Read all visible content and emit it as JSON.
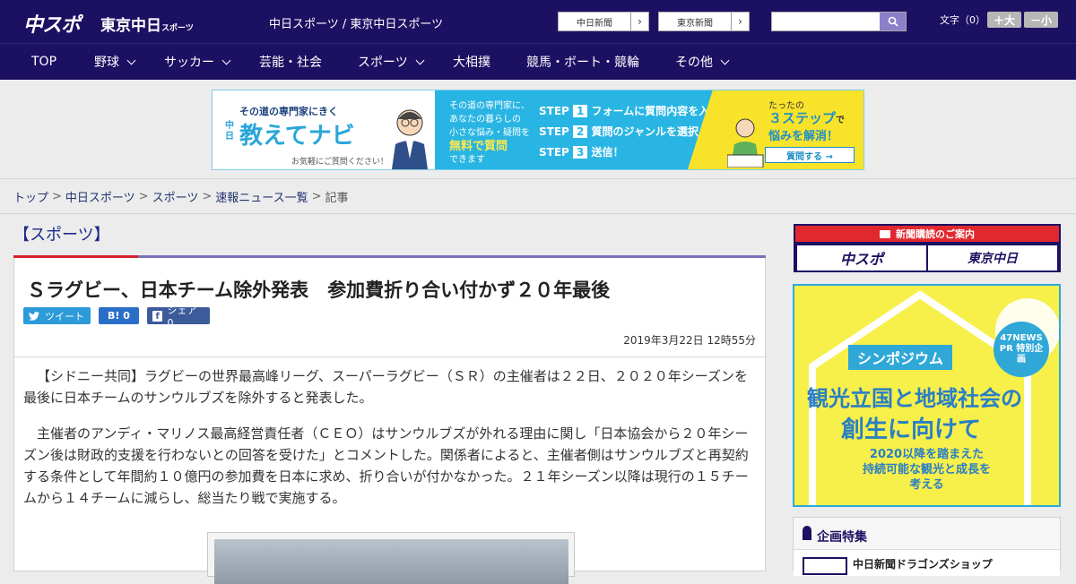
{
  "header": {
    "logo_chuspo": "中スポ",
    "logo_tokyo": "東京中日",
    "logo_tokyo_small": "スポーツ",
    "site_desc": "中日スポーツ / 東京中日スポーツ",
    "link_chunichi": "中日新聞",
    "link_tokyo": "東京新聞",
    "search_placeholder": "",
    "fontsize_label": "文字（0）",
    "font_up": "＋大",
    "font_down": "－小"
  },
  "nav": {
    "items": [
      {
        "label": "TOP"
      },
      {
        "label": "野球"
      },
      {
        "label": "サッカー"
      },
      {
        "label": "芸能・社会"
      },
      {
        "label": "スポーツ"
      },
      {
        "label": "大相撲"
      },
      {
        "label": "競馬・ボート・競輪"
      },
      {
        "label": "その他"
      }
    ]
  },
  "banner": {
    "tagline": "その道の専門家にきく",
    "brand_small": "中日",
    "brand": "教えてナビ",
    "note": "お気軽にご質問ください！",
    "mid_text1": "その道の専門家に、",
    "mid_text2": "あなたの暮らしの",
    "mid_text3": "小さな悩み・疑問を",
    "mid_free": "無料で質問",
    "mid_text4": "できます",
    "step1": "フォームに質問内容を入力",
    "step2": "質問のジャンルを選択",
    "step3": "送信！",
    "right_small": "たったの",
    "right_big": "３ステップ",
    "right_tail": "で",
    "right_solve": "悩みを解消！",
    "right_btn": "質問する →"
  },
  "breadcrumb": {
    "items": [
      "トップ",
      "中日スポーツ",
      "スポーツ",
      "速報ニュース一覧"
    ],
    "current": "記事",
    "sep": ">"
  },
  "article": {
    "category": "【スポーツ】",
    "headline": "Ｓラグビー、日本チーム除外発表　参加費折り合い付かず２０年最後",
    "share_tweet": "ツイート",
    "share_hatena": "B! 0",
    "share_fb": "シェア 0",
    "date": "2019年3月22日 12時55分",
    "para1": "【シドニー共同】ラグビーの世界最高峰リーグ、スーパーラグビー（ＳＲ）の主催者は２２日、２０２０年シーズンを最後に日本チームのサンウルブズを除外すると発表した。",
    "para2": "主催者のアンディ・マリノス最高経営責任者（ＣＥＯ）はサンウルブズが外れる理由に関し「日本協会から２０年シーズン後は財政的支援を行わないとの回答を受けた」とコメントした。関係者によると、主催者側はサンウルブズと再契約する条件として年間約１０億円の参加費を日本に求め、折り合いが付かなかった。２１年シーズン以降は現行の１５チームから１４チームに減らし、総当たり戦で実施する。"
  },
  "sidebar": {
    "subscribe_title": "新聞購読のご案内",
    "subscribe_chuspo": "中スポ",
    "subscribe_tokyo": "東京中日",
    "ad_badge": "47NEWS PR 特別企画",
    "ad_symposium": "シンポジウム",
    "ad_title1": "観光立国と地域社会の",
    "ad_title2": "創生に向けて",
    "ad_sub1": "2020以降を踏まえた",
    "ad_sub2": "持続可能な観光と成長を",
    "ad_sub3": "考える",
    "feature_title": "企画特集",
    "feature_item": "中日新聞ドラゴンズショップ"
  },
  "colors": {
    "header_bg": "#1c1062",
    "accent_red": "#d3232a",
    "link": "#22336e"
  }
}
